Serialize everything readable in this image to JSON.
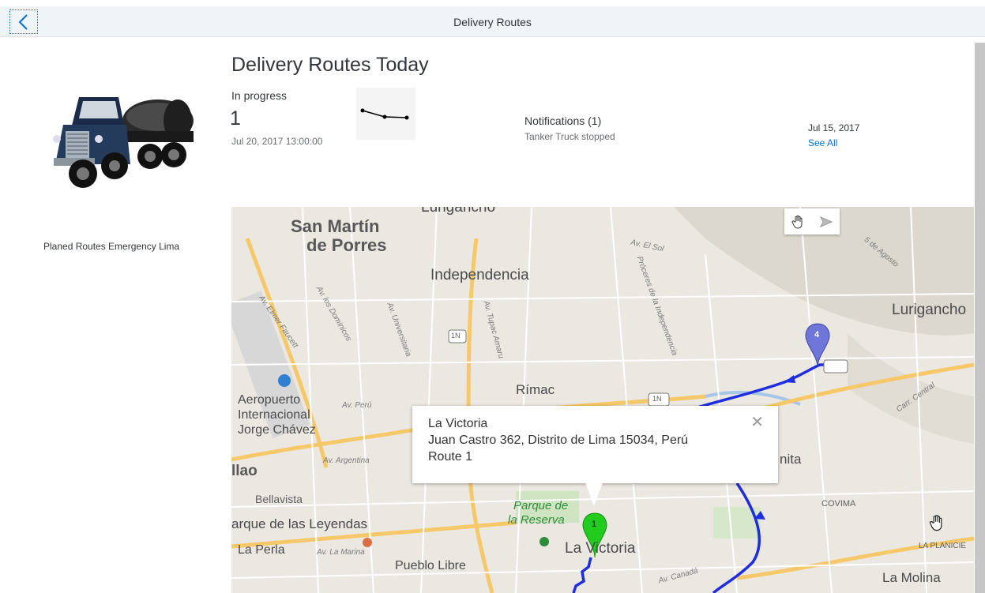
{
  "header": {
    "title": "Delivery Routes"
  },
  "sidebar": {
    "label": "Planed Routes Emergency Lima"
  },
  "main": {
    "title": "Delivery Routes Today",
    "kpi": {
      "label": "In progress",
      "value": "1",
      "timestamp": "Jul 20, 2017 13:00:00"
    },
    "notifications": {
      "title": "Notifications (1)",
      "text": "Tanker Truck stopped"
    },
    "date": "Jul 15, 2017",
    "see_all": "See All"
  },
  "map": {
    "labels": {
      "san_martin": "San Martín",
      "de_porres": "de Porres",
      "independencia": "Independencia",
      "lurigancho": "Lurigancho",
      "rimac": "Rímac",
      "aeropuerto1": "Aeropuerto",
      "aeropuerto2": "Internacional",
      "aeropuerto3": "Jorge Chávez",
      "callao": "llao",
      "bellavista": "Bellavista",
      "parque_leyendas": "arque de las Leyendas",
      "la_perla": "La Perla",
      "pueblo_libre": "Pueblo Libre",
      "la_victoria": "La Victoria",
      "parque_reserva1": "Parque de",
      "parque_reserva2": "la Reserva",
      "nita": "nita",
      "covima": "COVIMA",
      "la_planicie": "LA PLANICIE",
      "la_molina": "La Molina",
      "top_partial": "Lurigancho",
      "av_peru": "Av. Perú",
      "av_argentina": "Av. Argentina",
      "av_la_marina": "Av. La Marina",
      "av_el_sol": "Av. El Sol",
      "carr_central": "Carr. Central",
      "cinco_agosto": "5 de Agosto",
      "av_tupac": "Av. Tupac Amaru",
      "av_universitaria": "Av. Universitaria",
      "av_dominicos": "Av. los Dominicos",
      "av_faucett": "Av. Elmer Faucett",
      "proceres": "Próceres de la Independencia",
      "av_canada": "Av. Canadá",
      "shield_1n": "1N",
      "marker_1": "1",
      "marker_4": "4"
    },
    "popup": {
      "line1": "La Victoria",
      "line2": "Juan Castro 362, Distrito de Lima 15034, Perú",
      "line3": "Route 1",
      "close": "✕"
    },
    "route_color": "#1f2de0",
    "marker_green": "#22cc1f",
    "marker_purple": "#6e76d9"
  }
}
